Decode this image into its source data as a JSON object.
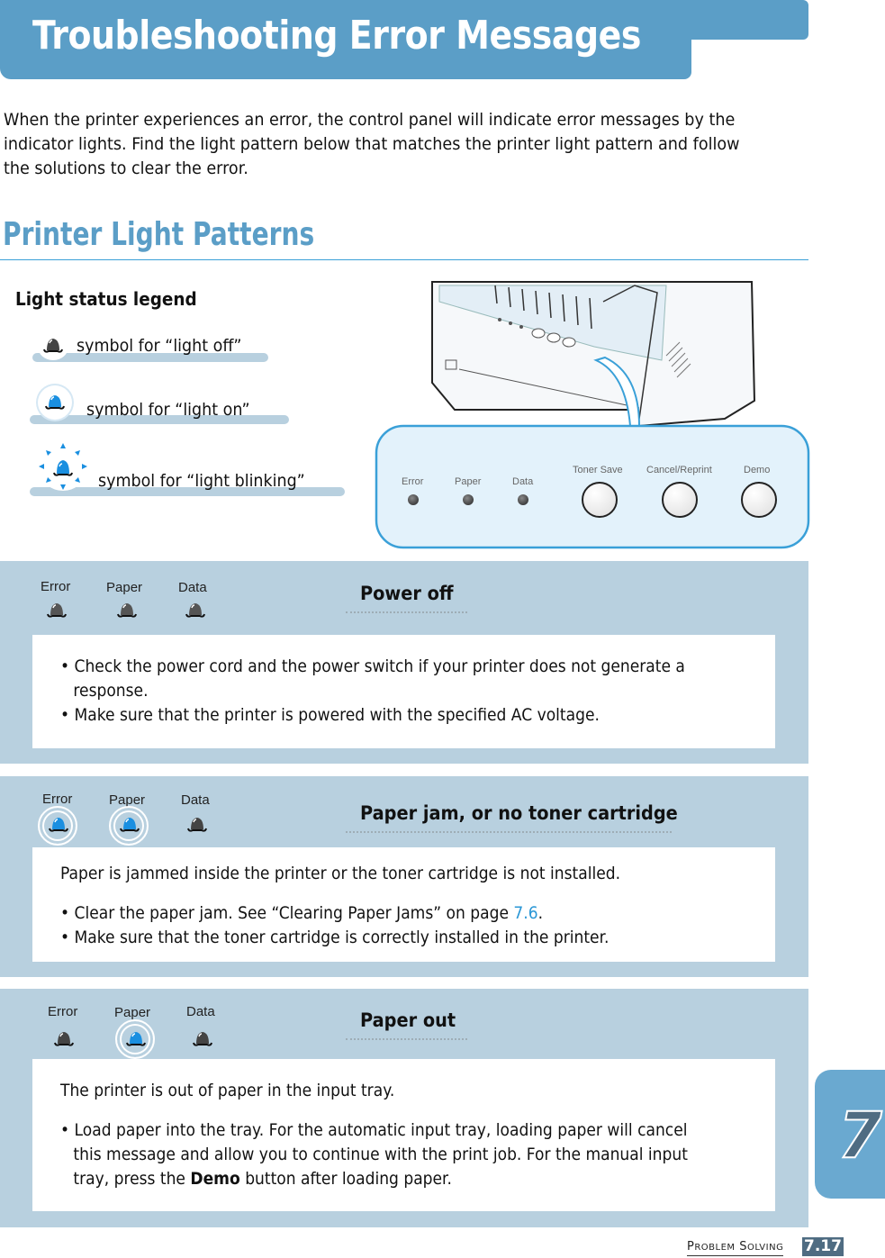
{
  "header": {
    "title": "Troubleshooting Error Messages"
  },
  "intro": "When the printer experiences an error, the control panel will indicate error messages by the indicator lights. Find the light pattern below that matches the printer light pattern and follow the solutions to clear the error.",
  "section_heading": "Printer Light Patterns",
  "legend": {
    "title": "Light status legend",
    "items": [
      {
        "state": "off",
        "label": "symbol for “light off”"
      },
      {
        "state": "on",
        "label": "symbol for “light on”"
      },
      {
        "state": "blinking",
        "label": "symbol for “light blinking”"
      }
    ]
  },
  "control_panel": {
    "lights": [
      "Error",
      "Paper",
      "Data"
    ],
    "buttons": [
      "Toner Save",
      "Cancel/Reprint",
      "Demo"
    ]
  },
  "patterns": [
    {
      "title": "Power off",
      "lights": [
        {
          "label": "Error",
          "state": "off"
        },
        {
          "label": "Paper",
          "state": "off"
        },
        {
          "label": "Data",
          "state": "off"
        }
      ],
      "description": "",
      "bullets": [
        "• Check the power cord and the power switch if your printer does not generate a",
        "response.",
        "• Make sure that the printer is powered with the specified AC voltage."
      ]
    },
    {
      "title": "Paper jam, or no toner cartridge",
      "lights": [
        {
          "label": "Error",
          "state": "on"
        },
        {
          "label": "Paper",
          "state": "on"
        },
        {
          "label": "Data",
          "state": "off"
        }
      ],
      "description": "Paper is jammed inside the printer or the toner cartridge is not installed.",
      "bullet1_prefix": "• Clear the paper jam. See “Clearing Paper Jams” on page ",
      "bullet1_link": "7.6",
      "bullet1_suffix": ".",
      "bullet2": "• Make sure that the toner cartridge is correctly installed in the printer."
    },
    {
      "title": "Paper out",
      "lights": [
        {
          "label": "Error",
          "state": "off"
        },
        {
          "label": "Paper",
          "state": "on"
        },
        {
          "label": "Data",
          "state": "off"
        }
      ],
      "description": "The printer is out of paper in the input tray.",
      "bullet_line1": "• Load paper into the tray. For the automatic input tray, loading paper will cancel",
      "bullet_line2": "this message and allow you to continue with the print job. For the manual input",
      "bullet_line3_prefix": "tray, press the ",
      "bullet_line3_bold": "Demo",
      "bullet_line3_suffix": " button after loading paper."
    }
  ],
  "chapter_tab": "7",
  "footer": {
    "section_first": "P",
    "section_first_rest": "ROBLEM",
    "section_second": "S",
    "section_second_rest": "OLVING",
    "page": "7.17"
  },
  "colors": {
    "brand_blue": "#5b9ec7",
    "panel_bg": "#b8d0df",
    "led_on": "#1a8fe0",
    "led_off": "#444444",
    "link": "#2a97d6",
    "page_badge": "#4f6c82"
  }
}
